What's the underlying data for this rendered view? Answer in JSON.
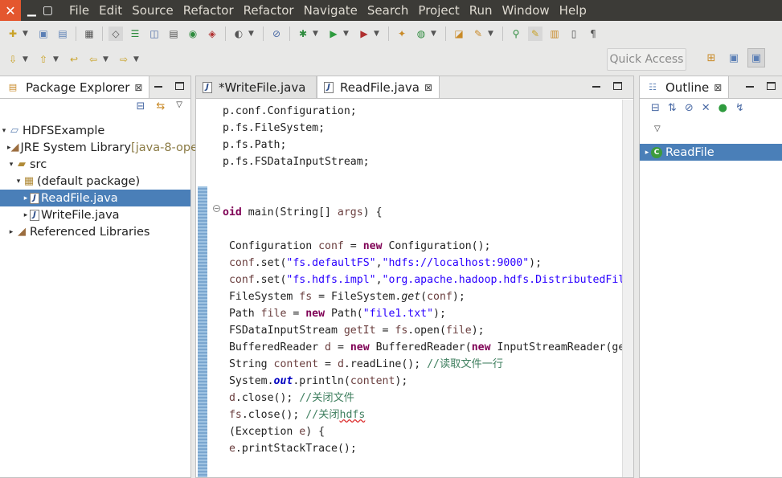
{
  "menubar": {
    "close_glyph": "✕",
    "items": [
      "File",
      "Edit",
      "Source",
      "Refactor",
      "Refactor",
      "Navigate",
      "Search",
      "Project",
      "Run",
      "Window",
      "Help"
    ]
  },
  "toolbar": {
    "quick_access": "Quick Access"
  },
  "package_explorer": {
    "tab_label": "Package Explorer",
    "tree": [
      {
        "label": "HDFSExample",
        "extra": "",
        "indent": 0,
        "twisty": "▾",
        "icon": "project",
        "selected": false
      },
      {
        "label": "JRE System Library ",
        "extra": "[java-8-ope",
        "indent": 1,
        "twisty": "▸",
        "icon": "library",
        "selected": false
      },
      {
        "label": "src",
        "extra": "",
        "indent": 1,
        "twisty": "▾",
        "icon": "folder",
        "selected": false
      },
      {
        "label": "(default package)",
        "extra": "",
        "indent": 2,
        "twisty": "▾",
        "icon": "package",
        "selected": false
      },
      {
        "label": "ReadFile.java",
        "extra": "",
        "indent": 3,
        "twisty": "▸",
        "icon": "java",
        "selected": true
      },
      {
        "label": "WriteFile.java",
        "extra": "",
        "indent": 3,
        "twisty": "▸",
        "icon": "java",
        "selected": false
      },
      {
        "label": "Referenced Libraries",
        "extra": "",
        "indent": 1,
        "twisty": "▸",
        "icon": "library",
        "selected": false
      }
    ]
  },
  "editor": {
    "tabs": [
      {
        "label": "*WriteFile.java",
        "active": false
      },
      {
        "label": "ReadFile.java",
        "active": true
      }
    ],
    "code_lines": [
      [
        [
          "p.conf.Configuration;",
          ""
        ]
      ],
      [
        [
          "p.fs.FileSystem;",
          ""
        ]
      ],
      [
        [
          "p.fs.Path;",
          ""
        ]
      ],
      [
        [
          "p.fs.FSDataInputStream;",
          ""
        ]
      ],
      [
        [
          "",
          ""
        ]
      ],
      [
        [
          "",
          ""
        ]
      ],
      [
        [
          "oid",
          "kw"
        ],
        [
          " main(String[] ",
          ""
        ],
        [
          "args",
          "var"
        ],
        [
          ") {",
          ""
        ]
      ],
      [
        [
          "",
          ""
        ]
      ],
      [
        [
          " Configuration ",
          ""
        ],
        [
          "conf",
          "var"
        ],
        [
          " = ",
          ""
        ],
        [
          "new",
          "kw"
        ],
        [
          " Configuration();",
          ""
        ]
      ],
      [
        [
          " ",
          ""
        ],
        [
          "conf",
          "var"
        ],
        [
          ".set(",
          ""
        ],
        [
          "\"fs.defaultFS\"",
          "str"
        ],
        [
          ",",
          ""
        ],
        [
          "\"hdfs://localhost:9000\"",
          "str"
        ],
        [
          ");",
          ""
        ]
      ],
      [
        [
          " ",
          ""
        ],
        [
          "conf",
          "var"
        ],
        [
          ".set(",
          ""
        ],
        [
          "\"fs.hdfs.impl\"",
          "str"
        ],
        [
          ",",
          ""
        ],
        [
          "\"org.apache.hadoop.hdfs.DistributedFil",
          "str"
        ]
      ],
      [
        [
          " FileSystem ",
          ""
        ],
        [
          "fs",
          "var"
        ],
        [
          " = FileSystem.",
          ""
        ],
        [
          "get",
          "it"
        ],
        [
          "(",
          ""
        ],
        [
          "conf",
          "var"
        ],
        [
          ");",
          ""
        ]
      ],
      [
        [
          " Path ",
          ""
        ],
        [
          "file",
          "var"
        ],
        [
          " = ",
          ""
        ],
        [
          "new",
          "kw"
        ],
        [
          " Path(",
          ""
        ],
        [
          "\"file1.txt\"",
          "str"
        ],
        [
          ");",
          ""
        ]
      ],
      [
        [
          " FSDataInputStream ",
          ""
        ],
        [
          "getIt",
          "var"
        ],
        [
          " = ",
          ""
        ],
        [
          "fs",
          "var"
        ],
        [
          ".open(",
          ""
        ],
        [
          "file",
          "var"
        ],
        [
          ");",
          ""
        ]
      ],
      [
        [
          " BufferedReader ",
          ""
        ],
        [
          "d",
          "var"
        ],
        [
          " = ",
          ""
        ],
        [
          "new",
          "kw"
        ],
        [
          " BufferedReader(",
          ""
        ],
        [
          "new",
          "kw"
        ],
        [
          " InputStreamReader(ge",
          ""
        ]
      ],
      [
        [
          " String ",
          ""
        ],
        [
          "content",
          "var"
        ],
        [
          " = ",
          ""
        ],
        [
          "d",
          "var"
        ],
        [
          ".readLine(); ",
          ""
        ],
        [
          "//读取文件一行",
          "cm"
        ]
      ],
      [
        [
          " System.",
          ""
        ],
        [
          "out",
          "st"
        ],
        [
          ".println(",
          ""
        ],
        [
          "content",
          "var"
        ],
        [
          ");",
          ""
        ]
      ],
      [
        [
          " ",
          ""
        ],
        [
          "d",
          "var"
        ],
        [
          ".close(); ",
          ""
        ],
        [
          "//关闭文件",
          "cm"
        ]
      ],
      [
        [
          " ",
          ""
        ],
        [
          "fs",
          "var"
        ],
        [
          ".close(); ",
          ""
        ],
        [
          "//关闭",
          "cm"
        ],
        [
          "hdfs",
          "cm squig"
        ]
      ],
      [
        [
          " (Exception ",
          ""
        ],
        [
          "e",
          "var"
        ],
        [
          ") {",
          ""
        ]
      ],
      [
        [
          " ",
          ""
        ],
        [
          "e",
          "var"
        ],
        [
          ".printStackTrace();",
          ""
        ]
      ]
    ]
  },
  "outline": {
    "tab_label": "Outline",
    "items": [
      {
        "label": "ReadFile",
        "selected": true
      }
    ]
  }
}
